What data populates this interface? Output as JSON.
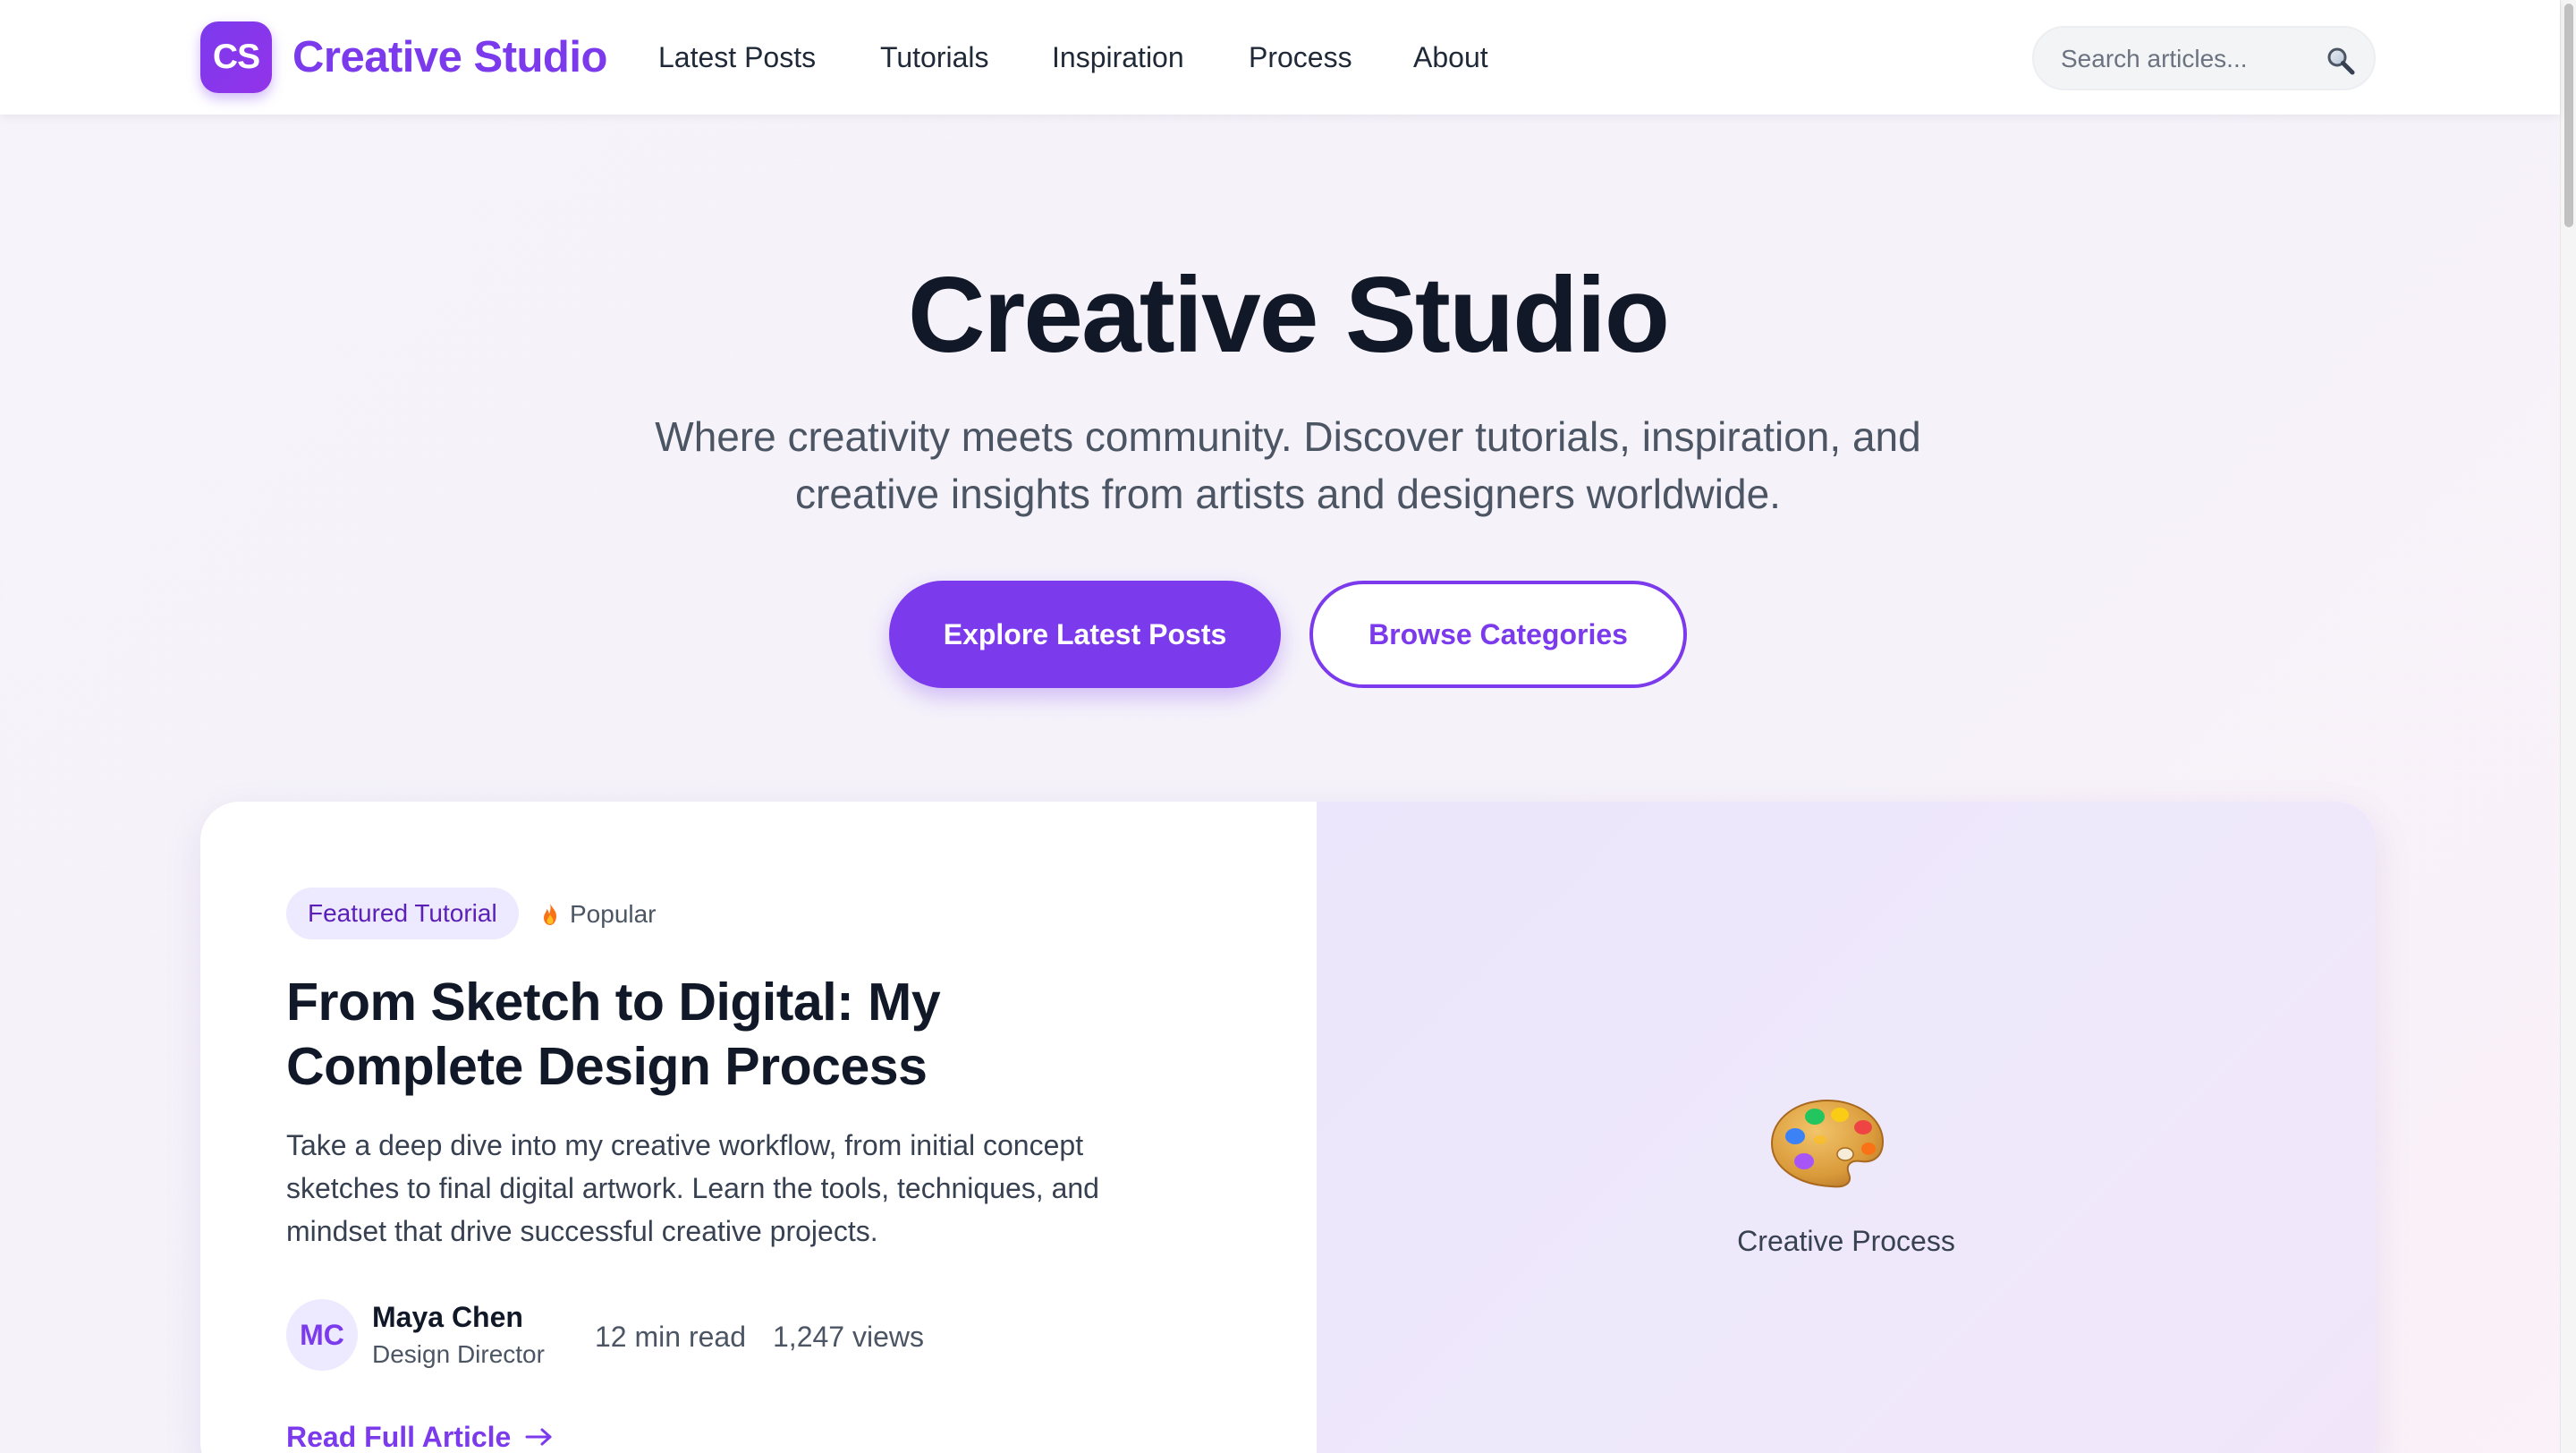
{
  "brand": {
    "badge": "CS",
    "name": "Creative Studio",
    "accent_color": "#7c3aed"
  },
  "nav": {
    "items": [
      {
        "label": "Latest Posts"
      },
      {
        "label": "Tutorials"
      },
      {
        "label": "Inspiration"
      },
      {
        "label": "Process"
      },
      {
        "label": "About"
      }
    ]
  },
  "search": {
    "placeholder": "Search articles...",
    "value": "",
    "icon": "search-icon"
  },
  "hero": {
    "title": "Creative Studio",
    "subtitle_line1": "Where creativity meets community. Discover tutorials, inspiration, and",
    "subtitle_line2": "creative insights from artists and designers worldwide.",
    "primary_button": "Explore Latest Posts",
    "secondary_button": "Browse Categories"
  },
  "featured": {
    "badge": "Featured Tutorial",
    "popular_label": "Popular",
    "popular_icon": "fire-icon",
    "title_line1": "From Sketch to Digital: My",
    "title_line2": "Complete Design Process",
    "excerpt_line1": "Take a deep dive into my creative workflow, from initial concept",
    "excerpt_line2": "sketches to final digital artwork. Learn the tools, techniques, and",
    "excerpt_line3": "mindset that drive successful creative projects.",
    "author": {
      "initials": "MC",
      "name": "Maya Chen",
      "role": "Design Director"
    },
    "read_time": "12 min read",
    "views": "1,247 views",
    "read_link": "Read Full Article",
    "read_link_icon": "arrow-right-icon",
    "media": {
      "icon": "palette-icon",
      "caption": "Creative Process"
    }
  }
}
